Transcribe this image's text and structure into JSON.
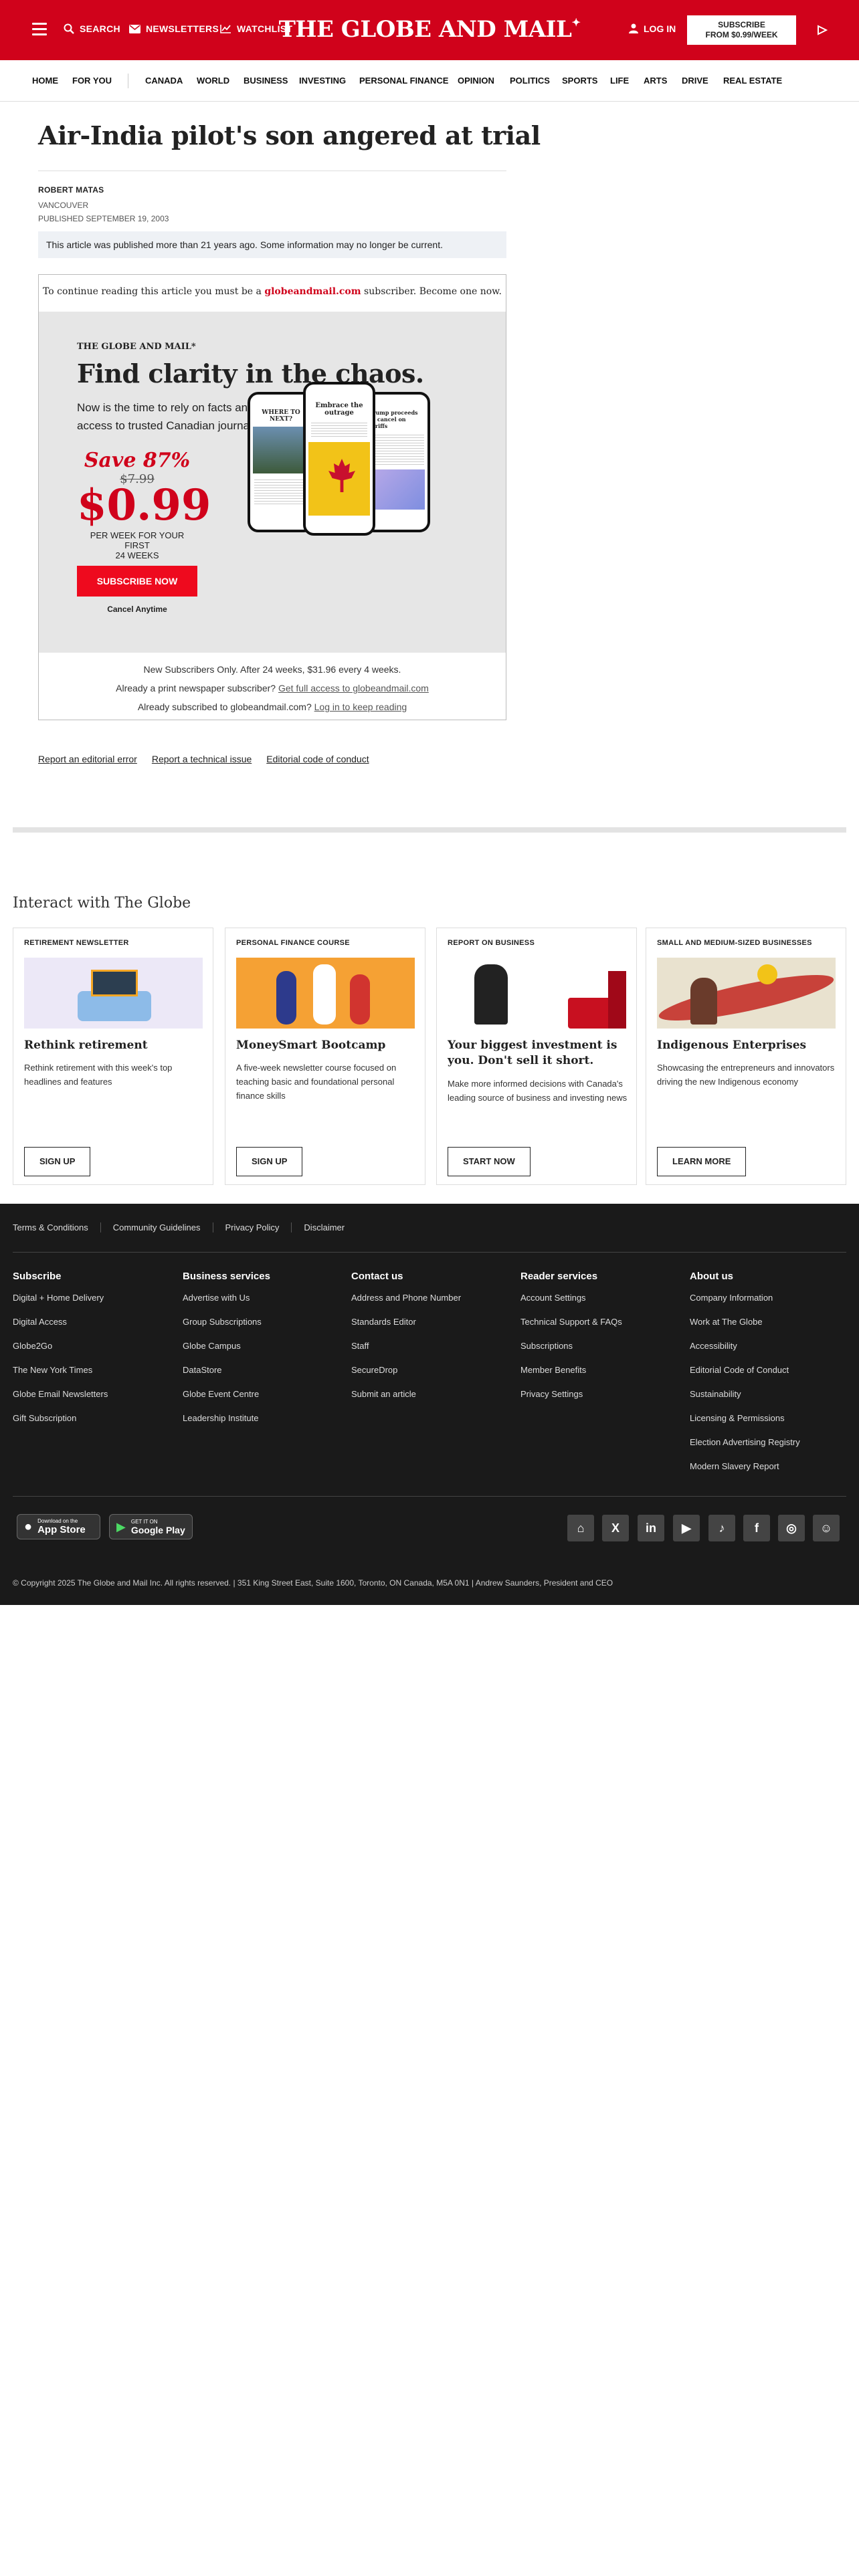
{
  "header": {
    "search": "SEARCH",
    "newsletters": "NEWSLETTERS",
    "watchlist": "WATCHLIST",
    "logo": "THE GLOBE AND MAIL",
    "login": "LOG IN",
    "subscribe_line1": "SUBSCRIBE",
    "subscribe_line2": "FROM $0.99/WEEK"
  },
  "nav": [
    "HOME",
    "FOR YOU",
    "CANADA",
    "WORLD",
    "BUSINESS",
    "INVESTING",
    "PERSONAL FINANCE",
    "OPINION",
    "POLITICS",
    "SPORTS",
    "LIFE",
    "ARTS",
    "DRIVE",
    "REAL ESTATE"
  ],
  "article": {
    "title": "Air-India pilot's son angered at trial",
    "author": "ROBERT MATAS",
    "location": "VANCOUVER",
    "published": "PUBLISHED SEPTEMBER 19, 2003",
    "notice": "This article was published more than 21 years ago. Some information may no longer be current."
  },
  "paywall": {
    "continue_pre": "To continue reading this article you must be a ",
    "continue_site": "globeandmail.com",
    "continue_post": " subscriber. Become one now.",
    "brand": "THE GLOBE AND MAIL*",
    "headline": "Find clarity in the chaos.",
    "sub": "Now is the time to rely on facts and timely analysis with full digital access to trusted Canadian journalism.",
    "save": "Save 87%",
    "old_price": "$7.99",
    "new_price": "$0.99",
    "per_week_1": "PER WEEK FOR YOUR FIRST",
    "per_week_2": "24 WEEKS",
    "subscribe_now": "SUBSCRIBE NOW",
    "cancel": "Cancel Anytime",
    "phone_left": "WHERE TO NEXT?",
    "phone_mid": "Embrace the outrage",
    "phone_right": "Trump proceeds to cancel on tariffs",
    "terms": "New Subscribers Only. After 24 weeks, $31.96 every 4 weeks.",
    "print_q": "Already a print newspaper subscriber? ",
    "print_link": "Get full access to globeandmail.com",
    "login_q": "Already subscribed to globeandmail.com? ",
    "login_link": "Log in to keep reading"
  },
  "article_links": [
    "Report an editorial error",
    "Report a technical issue",
    "Editorial code of conduct"
  ],
  "interact": {
    "heading": "Interact with The Globe",
    "cards": [
      {
        "eyebrow": "RETIREMENT NEWSLETTER",
        "title": "Rethink retirement",
        "desc": "Rethink retirement with this week's top headlines and features",
        "button": "SIGN UP"
      },
      {
        "eyebrow": "PERSONAL FINANCE COURSE",
        "title": "MoneySmart Bootcamp",
        "desc": "A five-week newsletter course focused on teaching basic and foundational personal finance skills",
        "button": "SIGN UP"
      },
      {
        "eyebrow": "REPORT ON BUSINESS",
        "title": "Your biggest investment is you. Don't sell it short.",
        "desc": "Make more informed decisions with Canada's leading source of business and investing news",
        "button": "START NOW"
      },
      {
        "eyebrow": "SMALL AND MEDIUM-SIZED BUSINESSES",
        "title": "Indigenous Enterprises",
        "desc": "Showcasing the entrepreneurs and innovators driving the new Indigenous economy",
        "button": "LEARN MORE"
      }
    ]
  },
  "footer": {
    "top_links": [
      "Terms & Conditions",
      "Community Guidelines",
      "Privacy Policy",
      "Disclaimer"
    ],
    "columns": [
      {
        "heading": "Subscribe",
        "items": [
          "Digital + Home Delivery",
          "Digital Access",
          "Globe2Go",
          "The New York Times",
          "Globe Email Newsletters",
          "Gift Subscription"
        ]
      },
      {
        "heading": "Business services",
        "items": [
          "Advertise with Us",
          "Group Subscriptions",
          "Globe Campus",
          "DataStore",
          "Globe Event Centre",
          "Leadership Institute"
        ]
      },
      {
        "heading": "Contact us",
        "items": [
          "Address and Phone Number",
          "Standards Editor",
          "Staff",
          "SecureDrop",
          "Submit an article"
        ]
      },
      {
        "heading": "Reader services",
        "items": [
          "Account Settings",
          "Technical Support & FAQs",
          "Subscriptions",
          "Member Benefits",
          "Privacy Settings"
        ]
      },
      {
        "heading": "About us",
        "items": [
          "Company Information",
          "Work at The Globe",
          "Accessibility",
          "Editorial Code of Conduct",
          "Sustainability",
          "Licensing & Permissions",
          "Election Advertising Registry",
          "Modern Slavery Report"
        ]
      }
    ],
    "appstore_small": "Download on the",
    "appstore": "App Store",
    "googleplay_small": "GET IT ON",
    "googleplay": "Google Play",
    "copyright": "© Copyright 2025 The Globe and Mail Inc. All rights reserved.   |   351 King Street East, Suite 1600, Toronto, ON Canada, M5A 0N1   |   Andrew Saunders, President and CEO"
  }
}
